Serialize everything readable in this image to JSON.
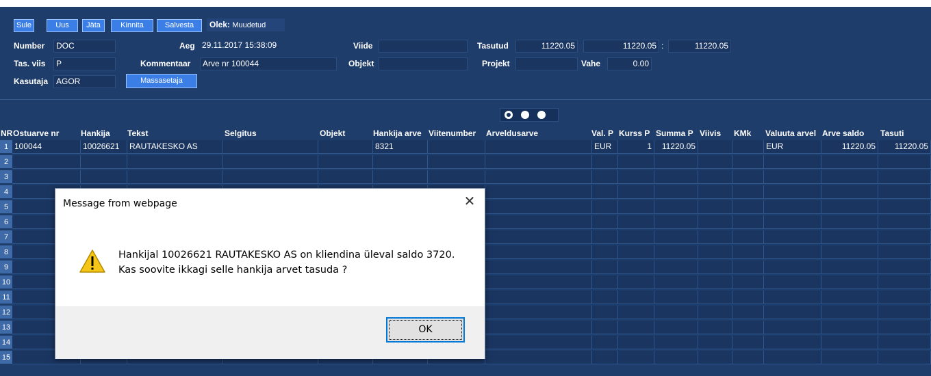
{
  "toolbar": {
    "buttons": [
      "Sule",
      "Uus",
      "Jäta",
      "Kinnita",
      "Salvesta"
    ],
    "status_label": "Olek:",
    "status_value": "Muudetud"
  },
  "form": {
    "number_label": "Number",
    "number_value": "DOC",
    "aeg_label": "Aeg",
    "aeg_value": "29.11.2017 15:38:09",
    "viide_label": "Viide",
    "viide_value": "",
    "tasutud_label": "Tasutud",
    "tasutud_value1": "11220.05",
    "tasutud_value2": "11220.05",
    "tasutud_sep": ":",
    "tasutud_value3": "11220.05",
    "tasviis_label": "Tas. viis",
    "tasviis_value": "P",
    "kommentaar_label": "Kommentaar",
    "kommentaar_value": "Arve nr 100044",
    "objekt_label": "Objekt",
    "objekt_value": "",
    "projekt_label": "Projekt",
    "projekt_value": "",
    "vahe_label": "Vahe",
    "vahe_value": "0.00",
    "kasutaja_label": "Kasutaja",
    "kasutaja_value": "AGOR",
    "massasetaja_label": "Massasetaja"
  },
  "grid": {
    "headers": [
      "NR",
      "Ostuarve nr",
      "Hankija",
      "Tekst",
      "Selgitus",
      "Objekt",
      "Hankija arve",
      "Viitenumber",
      "Arveldusarve",
      "Val. P",
      "Kurss P",
      "Summa P",
      "Viivis",
      "KMk",
      "Valuuta arvel",
      "Arve saldo",
      "Tasuti"
    ],
    "row1": [
      "100044",
      "10026621",
      "RAUTAKESKO AS",
      "",
      "",
      "8321",
      "",
      "",
      "EUR",
      "1",
      "11220.05",
      "",
      "",
      "EUR",
      "11220.05",
      "11220.05"
    ],
    "row_numbers": [
      "1",
      "2",
      "3",
      "4",
      "5",
      "6",
      "7",
      "8",
      "9",
      "10",
      "11",
      "12",
      "13",
      "14",
      "15"
    ]
  },
  "dialog": {
    "title": "Message from webpage",
    "message": "Hankijal 10026621 RAUTAKESKO AS on kliendina üleval saldo 3720. Kas soovite ikkagi selle hankija arvet tasuda ?",
    "ok_label": "OK",
    "icon": "warning-icon"
  },
  "colors": {
    "background": "#1f3d6b",
    "button": "#3b7fe6",
    "field": "#1a3560",
    "row_number": "#3f6aa8",
    "warning": "#f5c518"
  }
}
